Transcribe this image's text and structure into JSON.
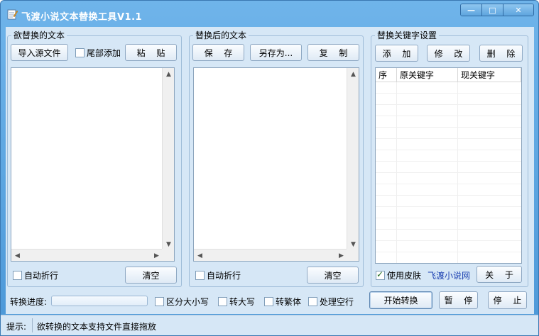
{
  "window": {
    "title": "飞渡小说文本替换工具V1.1",
    "controls": {
      "minimize": "—",
      "maximize": "□",
      "close": "✕"
    }
  },
  "source_panel": {
    "label": "欲替换的文本",
    "import_button": "导入源文件",
    "append_tail_checkbox": "尾部添加",
    "paste_button": "粘 贴",
    "word_wrap_checkbox": "自动折行",
    "clear_button": "清空"
  },
  "result_panel": {
    "label": "替换后的文本",
    "save_button": "保 存",
    "save_as_button": "另存为...",
    "copy_button": "复 制",
    "word_wrap_checkbox": "自动折行",
    "clear_button": "清空"
  },
  "keyword_panel": {
    "label": "替换关键字设置",
    "add_button": "添 加",
    "edit_button": "修 改",
    "delete_button": "删 除",
    "columns": [
      "序",
      "原关键字",
      "现关键字"
    ],
    "skin_checkbox": "使用皮肤",
    "skin_checked": true,
    "site_link": "飞渡小说网",
    "about_button": "关 于"
  },
  "bottom": {
    "progress_label": "转换进度:",
    "progress_value": 0,
    "case_sensitive": "区分大小写",
    "to_upper": "转大写",
    "to_traditional": "转繁体",
    "handle_blank_lines": "处理空行",
    "start_button": "开始转换",
    "pause_button": "暂 停",
    "stop_button": "停 止"
  },
  "status": {
    "hint_label": "提示:",
    "hint_text": "欲转换的文本支持文件直接拖放"
  },
  "colors": {
    "title_bar": "#5aa3e0",
    "client": "#d6e7f6",
    "link": "#1a3fb0"
  },
  "icons": [
    "notepad-icon",
    "minimize-icon",
    "maximize-icon",
    "close-icon"
  ]
}
